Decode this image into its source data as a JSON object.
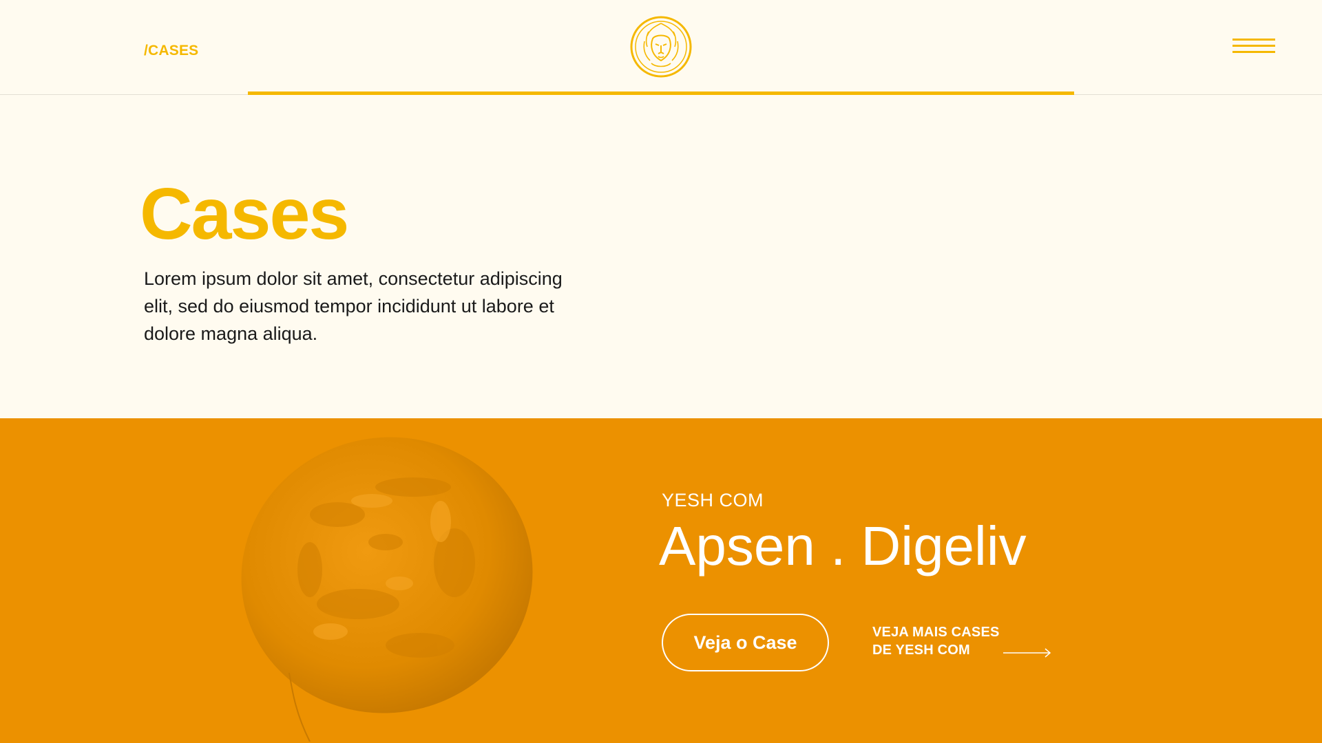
{
  "header": {
    "breadcrumb": "/CASES",
    "logo_icon": "lion-emblem-icon",
    "menu_icon": "hamburger-menu-icon",
    "accent_color": "#F5B800"
  },
  "intro": {
    "title": "Cases",
    "description": "Lorem ipsum dolor sit amet, consectetur adipiscing elit, sed do eiusmod tempor incididunt ut labore et dolore magna aliqua."
  },
  "featured_case": {
    "eyebrow": "YESH COM",
    "title": "Apsen . Digeliv",
    "cta_label": "Veja o Case",
    "more_link_line1": "VEJA MAIS CASES",
    "more_link_line2": "DE YESH COM",
    "arrow_icon": "arrow-right-icon",
    "image_icon": "balloon-image",
    "band_color": "#EC9100"
  }
}
